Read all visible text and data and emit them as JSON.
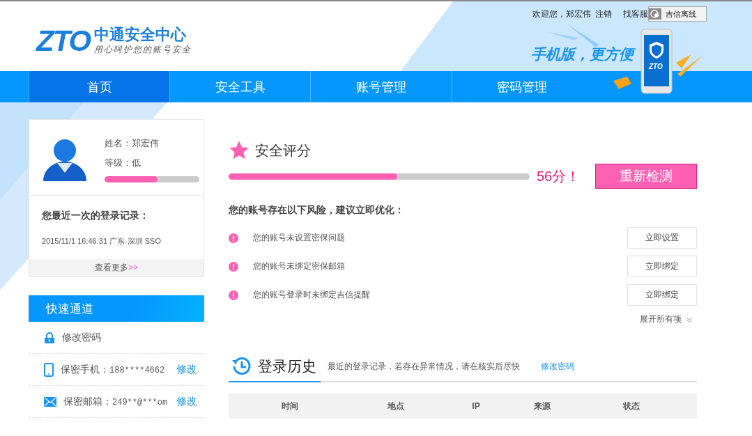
{
  "header": {
    "logo_mark": "ZTO",
    "logo_title": "中通安全中心",
    "logo_slogan": "用心呵护您的账号安全",
    "welcome": "欢迎您，郑宏伟",
    "logout": "注销",
    "support": "找客服",
    "im_status": "吉信离线",
    "promo": "手机版，更方便",
    "phone_logo": "ZTO"
  },
  "nav": [
    {
      "label": "首页",
      "selected": true
    },
    {
      "label": "安全工具",
      "selected": false
    },
    {
      "label": "账号管理",
      "selected": false
    },
    {
      "label": "密码管理",
      "selected": false
    }
  ],
  "profile": {
    "name_label": "姓名：郑宏伟",
    "level_label": "等级：低",
    "level": 0.56
  },
  "last_login": {
    "title": "您最近一次的登录记录：",
    "record": "2015/11/1 16:46:31 广东-深圳 SSO",
    "more": "查看更多",
    "more_arrows": ">>"
  },
  "quick_links": {
    "title": "快速通道",
    "items": [
      {
        "kind": "lock",
        "label": "修改密码"
      },
      {
        "kind": "phone",
        "label": "保密手机：",
        "value": "188****4662",
        "action": "修改"
      },
      {
        "kind": "mail",
        "label": "保密邮箱：",
        "value": "249**@***om",
        "action": "修改"
      }
    ]
  },
  "security": {
    "title": "安全评分",
    "level": 0.56,
    "score": "56分！",
    "recheck": "重新检测",
    "risk_title": "您的账号存在以下风险，建议立即优化：",
    "risks": [
      {
        "text": "您的账号未设置密保问题",
        "action": "立即设置"
      },
      {
        "text": "您的账号未绑定密保邮箱",
        "action": "立即绑定"
      },
      {
        "text": "您的账号登录时未绑定吉信提醒",
        "action": "立即绑定"
      }
    ],
    "expand": "展开所有项"
  },
  "history": {
    "title": "登录历史",
    "note": "最近的登录记录，若存在异常情况，请在核实后尽快",
    "link": "修改密码",
    "columns": [
      "时间",
      "地点",
      "IP",
      "来源",
      "状态"
    ]
  }
}
